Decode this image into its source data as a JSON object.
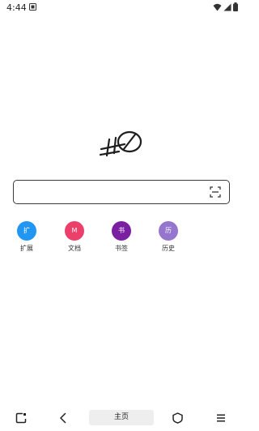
{
  "status_bar": {
    "time": "4:44"
  },
  "search": {
    "value": "",
    "placeholder": ""
  },
  "quick_links": [
    {
      "label": "扩展",
      "glyph": "扩",
      "color": "#2196f3",
      "icon": "extensions-icon"
    },
    {
      "label": "文档",
      "glyph": "M",
      "color": "#ec3f69",
      "icon": "documents-icon"
    },
    {
      "label": "书签",
      "glyph": "书",
      "color": "#7b1fa2",
      "icon": "bookmarks-icon"
    },
    {
      "label": "历史",
      "glyph": "历",
      "color": "#9575cd",
      "icon": "history-icon"
    }
  ],
  "bottom_nav": {
    "home_label": "主页"
  }
}
